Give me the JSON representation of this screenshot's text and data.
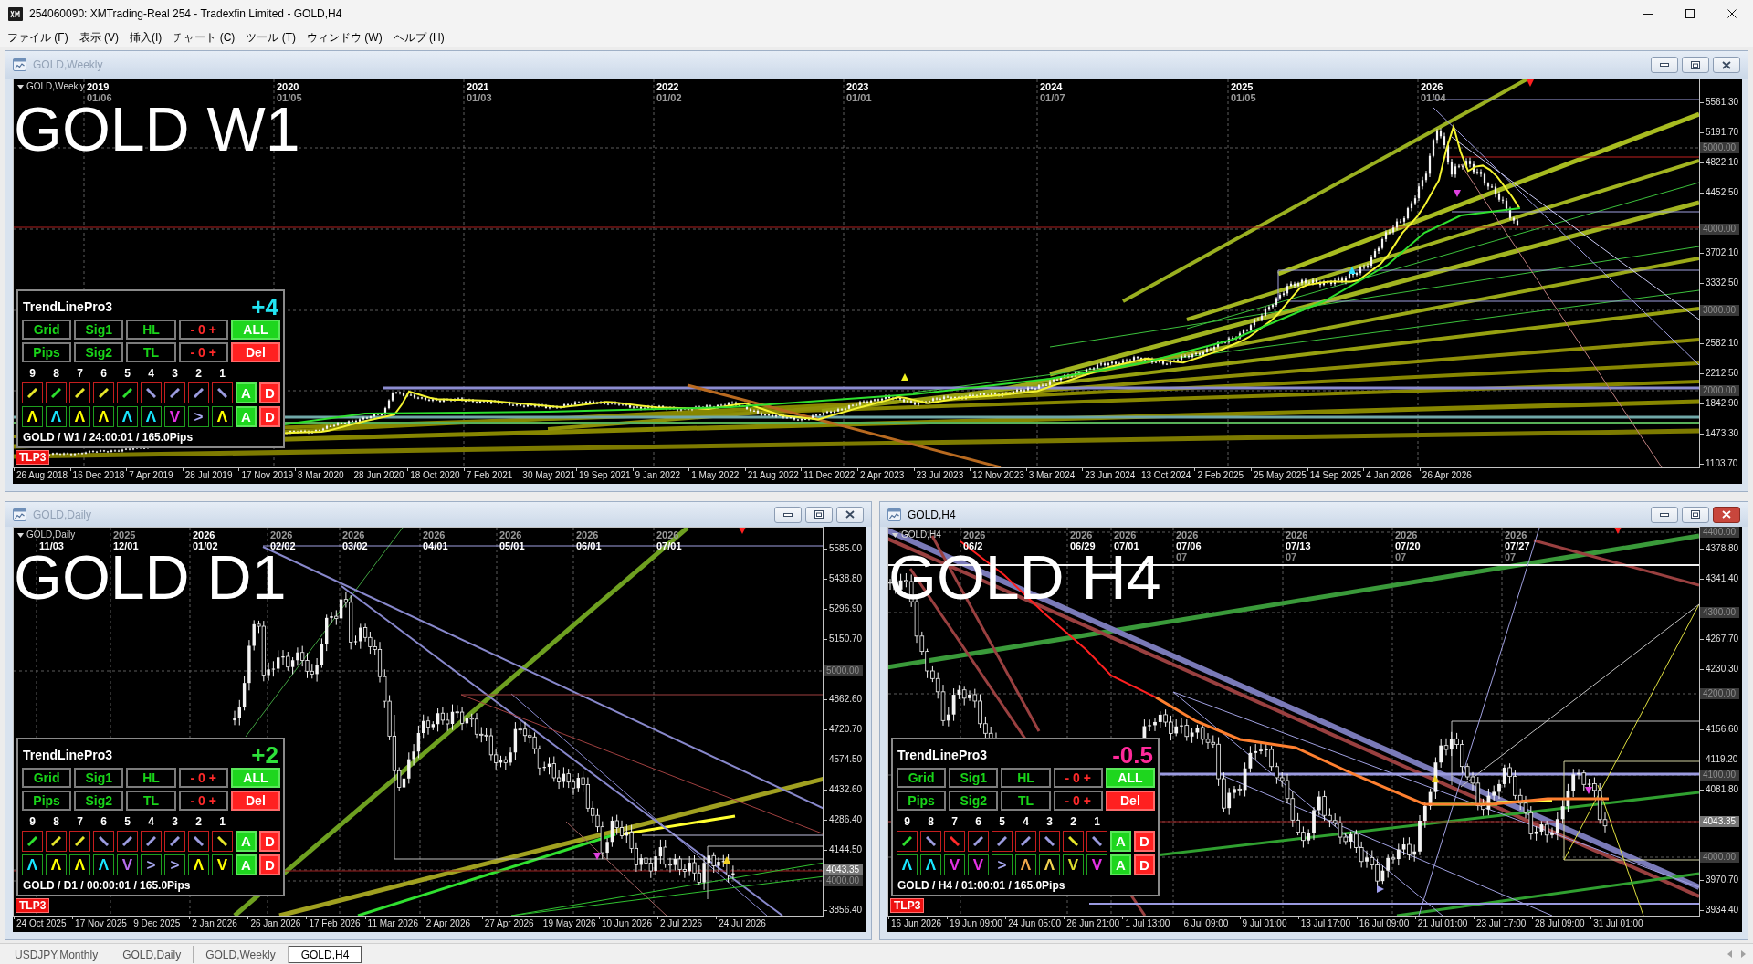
{
  "window": {
    "title": "254060090: XMTrading-Real 254 - Tradexfin Limited - GOLD,H4"
  },
  "menu": [
    "ファイル (F)",
    "表示 (V)",
    "挿入(I)",
    "チャート (C)",
    "ツール (T)",
    "ウィンドウ (W)",
    "ヘルプ (H)"
  ],
  "charts": [
    {
      "title": "GOLD,Weekly",
      "active": false,
      "symbol": "GOLD,Weekly",
      "label": "GOLD W1",
      "top_dates": [
        {
          "year": "2019",
          "date": "01/06",
          "year_highlighted": true,
          "date_highlighted": false
        },
        {
          "year": "2020",
          "date": "01/05",
          "year_highlighted": true,
          "date_highlighted": false
        },
        {
          "year": "2021",
          "date": "01/03",
          "year_highlighted": true,
          "date_highlighted": false
        },
        {
          "year": "2022",
          "date": "01/02",
          "year_highlighted": true,
          "date_highlighted": false
        },
        {
          "year": "2023",
          "date": "01/01",
          "year_highlighted": true,
          "date_highlighted": false
        },
        {
          "year": "2024",
          "date": "01/07",
          "year_highlighted": true,
          "date_highlighted": false
        },
        {
          "year": "2025",
          "date": "01/05",
          "year_highlighted": true,
          "date_highlighted": false
        },
        {
          "year": "2026",
          "date": "01/04",
          "year_highlighted": true,
          "date_highlighted": false
        }
      ],
      "price_ticks": [
        "5561.30",
        "5191.70",
        "4822.10",
        "4452.50",
        "3702.10",
        "3332.50",
        "2582.10",
        "2212.50",
        "1842.90",
        "1473.30",
        "1103.70"
      ],
      "price_marks": [
        {
          "text": "5000.00",
          "kind": "level"
        },
        {
          "text": "4000.00",
          "kind": "level"
        },
        {
          "text": "3000.00",
          "kind": "level"
        },
        {
          "text": "2000.00",
          "kind": "level"
        }
      ],
      "time_ticks": [
        "26 Aug 2018",
        "16 Dec 2018",
        "7 Apr 2019",
        "28 Jul 2019",
        "17 Nov 2019",
        "8 Mar 2020",
        "28 Jun 2020",
        "18 Oct 2020",
        "7 Feb 2021",
        "30 May 2021",
        "19 Sep 2021",
        "9 Jan 2022",
        "1 May 2022",
        "21 Aug 2022",
        "11 Dec 2022",
        "2 Apr 2023",
        "23 Jul 2023",
        "12 Nov 2023",
        "3 Mar 2024",
        "23 Jun 2024",
        "13 Oct 2024",
        "2 Feb 2025",
        "25 May 2025",
        "14 Sep 2025",
        "4 Jan 2026",
        "26 Apr 2026"
      ],
      "panel": {
        "title": "TrendLinePro3",
        "score": {
          "text": "+4",
          "color": "#22e4f2"
        },
        "buttons": [
          {
            "label": "Grid",
            "kind": "toggle"
          },
          {
            "label": "Sig1",
            "kind": "toggle"
          },
          {
            "label": "HL",
            "kind": "toggle"
          },
          {
            "label": "- 0 +",
            "kind": "stepper"
          },
          {
            "label": "ALL",
            "kind": "confirm"
          },
          {
            "label": "Pips",
            "kind": "toggle"
          },
          {
            "label": "Sig2",
            "kind": "toggle"
          },
          {
            "label": "TL",
            "kind": "toggle"
          },
          {
            "label": "- 0 +",
            "kind": "stepper"
          },
          {
            "label": "Del",
            "kind": "danger"
          }
        ],
        "slots": [
          {
            "number": "9",
            "line": {
              "kind": "rising",
              "color": "#e6e62a"
            },
            "arrow": {
              "symbol": "Λ",
              "color": "#ffff00"
            }
          },
          {
            "number": "8",
            "line": {
              "kind": "rising",
              "color": "#2ee02e"
            },
            "arrow": {
              "symbol": "Λ",
              "color": "#19e6ff"
            }
          },
          {
            "number": "7",
            "line": {
              "kind": "rising",
              "color": "#e6e62a"
            },
            "arrow": {
              "symbol": "Λ",
              "color": "#ffff00"
            }
          },
          {
            "number": "6",
            "line": {
              "kind": "rising",
              "color": "#e6e62a"
            },
            "arrow": {
              "symbol": "Λ",
              "color": "#ffff00"
            }
          },
          {
            "number": "5",
            "line": {
              "kind": "rising",
              "color": "#2ee02e"
            },
            "arrow": {
              "symbol": "Λ",
              "color": "#19e6ff"
            }
          },
          {
            "number": "4",
            "line": {
              "kind": "falling",
              "color": "#9c9ce0"
            },
            "arrow": {
              "symbol": "Λ",
              "color": "#19e6ff"
            }
          },
          {
            "number": "3",
            "line": {
              "kind": "rising",
              "color": "#9c9ce0"
            },
            "arrow": {
              "symbol": "V",
              "color": "#e632e6"
            }
          },
          {
            "number": "2",
            "line": {
              "kind": "rising",
              "color": "#9c9ce0"
            },
            "arrow": {
              "symbol": ">",
              "color": "#a8a8f0"
            }
          },
          {
            "number": "1",
            "line": {
              "kind": "falling",
              "color": "#9c9ce0"
            },
            "arrow": {
              "symbol": "Λ",
              "color": "#ffff00"
            }
          }
        ],
        "line_actions": [
          {
            "label": "A",
            "kind": "confirm"
          },
          {
            "label": "D",
            "kind": "danger"
          }
        ],
        "arrow_actions": [
          {
            "label": "A",
            "kind": "confirm"
          },
          {
            "label": "D",
            "kind": "danger"
          }
        ],
        "status": "GOLD / W1 / 24:00:01 / 165.0Pips"
      },
      "badge": "TLP3"
    },
    {
      "title": "GOLD,Daily",
      "active": false,
      "symbol": "GOLD,Daily",
      "label": "GOLD D1",
      "top_dates": [
        {
          "date": "11/03",
          "date_highlighted": true
        },
        {
          "year": "2025",
          "date": "12/01",
          "year_highlighted": false,
          "date_highlighted": true
        },
        {
          "year": "2026",
          "date": "01/02",
          "year_highlighted": true,
          "date_highlighted": true
        },
        {
          "year": "2026",
          "date": "02/02",
          "year_highlighted": false,
          "date_highlighted": true
        },
        {
          "year": "2026",
          "date": "03/02",
          "year_highlighted": false,
          "date_highlighted": true
        },
        {
          "year": "2026",
          "date": "04/01",
          "year_highlighted": false,
          "date_highlighted": true
        },
        {
          "year": "2026",
          "date": "05/01",
          "year_highlighted": false,
          "date_highlighted": true
        },
        {
          "year": "2026",
          "date": "06/01",
          "year_highlighted": false,
          "date_highlighted": true
        },
        {
          "year": "2026",
          "date": "07/01",
          "year_highlighted": false,
          "date_highlighted": true
        }
      ],
      "price_ticks": [
        "5585.00",
        "5438.80",
        "5296.90",
        "5150.70",
        "4862.60",
        "4720.70",
        "4574.50",
        "4432.60",
        "4286.40",
        "4144.50",
        "3856.40"
      ],
      "price_marks": [
        {
          "text": "5000.00",
          "kind": "level"
        },
        {
          "text": "4043.35",
          "kind": "bid"
        },
        {
          "text": "4000.00",
          "kind": "level"
        }
      ],
      "time_ticks": [
        "24 Oct 2025",
        "17 Nov 2025",
        "9 Dec 2025",
        "2 Jan 2026",
        "26 Jan 2026",
        "17 Feb 2026",
        "11 Mar 2026",
        "2 Apr 2026",
        "27 Apr 2026",
        "19 May 2026",
        "10 Jun 2026",
        "2 Jul 2026",
        "24 Jul 2026"
      ],
      "panel": {
        "title": "TrendLinePro3",
        "score": {
          "text": "+2",
          "color": "#2ee03a"
        },
        "buttons": [
          {
            "label": "Grid",
            "kind": "toggle"
          },
          {
            "label": "Sig1",
            "kind": "toggle"
          },
          {
            "label": "HL",
            "kind": "toggle"
          },
          {
            "label": "- 0 +",
            "kind": "stepper"
          },
          {
            "label": "ALL",
            "kind": "confirm"
          },
          {
            "label": "Pips",
            "kind": "toggle"
          },
          {
            "label": "Sig2",
            "kind": "toggle"
          },
          {
            "label": "TL",
            "kind": "toggle"
          },
          {
            "label": "- 0 +",
            "kind": "stepper"
          },
          {
            "label": "Del",
            "kind": "danger"
          }
        ],
        "slots": [
          {
            "number": "9",
            "line": {
              "kind": "rising",
              "color": "#2ee02e"
            },
            "arrow": {
              "symbol": "Λ",
              "color": "#19e6ff"
            }
          },
          {
            "number": "8",
            "line": {
              "kind": "rising",
              "color": "#e6e62a"
            },
            "arrow": {
              "symbol": "Λ",
              "color": "#ffff00"
            }
          },
          {
            "number": "7",
            "line": {
              "kind": "rising",
              "color": "#e6e62a"
            },
            "arrow": {
              "symbol": "Λ",
              "color": "#ffff00"
            }
          },
          {
            "number": "6",
            "line": {
              "kind": "falling",
              "color": "#9c9ce0"
            },
            "arrow": {
              "symbol": "Λ",
              "color": "#19e6ff"
            }
          },
          {
            "number": "5",
            "line": {
              "kind": "rising",
              "color": "#9c9ce0"
            },
            "arrow": {
              "symbol": "V",
              "color": "#b86ef0"
            }
          },
          {
            "number": "4",
            "line": {
              "kind": "rising",
              "color": "#9c9ce0"
            },
            "arrow": {
              "symbol": ">",
              "color": "#a8a8f0"
            }
          },
          {
            "number": "3",
            "line": {
              "kind": "rising",
              "color": "#9c9ce0"
            },
            "arrow": {
              "symbol": ">",
              "color": "#a8a8f0"
            }
          },
          {
            "number": "2",
            "line": {
              "kind": "falling",
              "color": "#9c9ce0"
            },
            "arrow": {
              "symbol": "Λ",
              "color": "#ffff00"
            }
          },
          {
            "number": "1",
            "line": {
              "kind": "falling",
              "color": "#e6e62a"
            },
            "arrow": {
              "symbol": "V",
              "color": "#ffff00"
            }
          }
        ],
        "line_actions": [
          {
            "label": "A",
            "kind": "confirm"
          },
          {
            "label": "D",
            "kind": "danger"
          }
        ],
        "arrow_actions": [
          {
            "label": "A",
            "kind": "confirm"
          },
          {
            "label": "D",
            "kind": "danger"
          }
        ],
        "status": "GOLD / D1 / 00:00:01 / 165.0Pips"
      },
      "badge": "TLP3"
    },
    {
      "title": "GOLD,H4",
      "active": true,
      "symbol": "GOLD,H4",
      "label": "GOLD H4",
      "top_dates": [
        {
          "year": "2026",
          "date": "06/2",
          "year_highlighted": false,
          "date_highlighted": true
        },
        {
          "year": "2026",
          "date": "06/29",
          "year_highlighted": false,
          "date_highlighted": true
        },
        {
          "year": "2026",
          "date": "07/01",
          "year_highlighted": false,
          "date_highlighted": true
        },
        {
          "year": "2026",
          "date": "07/06",
          "sub": "07",
          "year_highlighted": false,
          "date_highlighted": true
        },
        {
          "year": "2026",
          "date": "07/13",
          "sub": "07",
          "year_highlighted": false,
          "date_highlighted": true
        },
        {
          "year": "2026",
          "date": "07/20",
          "sub": "07",
          "year_highlighted": false,
          "date_highlighted": true
        },
        {
          "year": "2026",
          "date": "07/27",
          "sub": "07",
          "year_highlighted": false,
          "date_highlighted": true
        }
      ],
      "price_ticks": [
        "4378.80",
        "4341.40",
        "4267.70",
        "4230.30",
        "4156.60",
        "4119.20",
        "4081.80",
        "3970.70",
        "3934.40"
      ],
      "price_marks": [
        {
          "text": "4400.00",
          "kind": "level"
        },
        {
          "text": "4300.00",
          "kind": "level"
        },
        {
          "text": "4200.00",
          "kind": "level"
        },
        {
          "text": "4100.00",
          "kind": "level"
        },
        {
          "text": "4043.35",
          "kind": "bid"
        },
        {
          "text": "4000.00",
          "kind": "level"
        }
      ],
      "time_ticks": [
        "16 Jun 2026",
        "19 Jun 09:00",
        "24 Jun 05:00",
        "26 Jun 21:00",
        "1 Jul 13:00",
        "6 Jul 09:00",
        "9 Jul 01:00",
        "13 Jul 17:00",
        "16 Jul 09:00",
        "21 Jul 01:00",
        "23 Jul 17:00",
        "28 Jul 09:00",
        "31 Jul 01:00"
      ],
      "panel": {
        "title": "TrendLinePro3",
        "score": {
          "text": "-0.5",
          "color": "#ff2a9a"
        },
        "buttons": [
          {
            "label": "Grid",
            "kind": "toggle"
          },
          {
            "label": "Sig1",
            "kind": "toggle"
          },
          {
            "label": "HL",
            "kind": "toggle"
          },
          {
            "label": "- 0 +",
            "kind": "stepper"
          },
          {
            "label": "ALL",
            "kind": "confirm"
          },
          {
            "label": "Pips",
            "kind": "toggle"
          },
          {
            "label": "Sig2",
            "kind": "toggle"
          },
          {
            "label": "TL",
            "kind": "toggle"
          },
          {
            "label": "- 0 +",
            "kind": "stepper"
          },
          {
            "label": "Del",
            "kind": "danger"
          }
        ],
        "slots": [
          {
            "number": "9",
            "line": {
              "kind": "rising",
              "color": "#2ee02e"
            },
            "arrow": {
              "symbol": "Λ",
              "color": "#19e6ff"
            }
          },
          {
            "number": "8",
            "line": {
              "kind": "falling",
              "color": "#9c9ce0"
            },
            "arrow": {
              "symbol": "Λ",
              "color": "#19e6ff"
            }
          },
          {
            "number": "7",
            "line": {
              "kind": "falling",
              "color": "#ff2a2a"
            },
            "arrow": {
              "symbol": "V",
              "color": "#e632e6"
            }
          },
          {
            "number": "6",
            "line": {
              "kind": "rising",
              "color": "#9c9ce0"
            },
            "arrow": {
              "symbol": "V",
              "color": "#e632e6"
            }
          },
          {
            "number": "5",
            "line": {
              "kind": "rising",
              "color": "#9c9ce0"
            },
            "arrow": {
              "symbol": ">",
              "color": "#a8a8f0"
            }
          },
          {
            "number": "4",
            "line": {
              "kind": "rising",
              "color": "#9c9ce0"
            },
            "arrow": {
              "symbol": "Λ",
              "color": "#f0a84a"
            }
          },
          {
            "number": "3",
            "line": {
              "kind": "falling",
              "color": "#9c9ce0"
            },
            "arrow": {
              "symbol": "Λ",
              "color": "#f0d050"
            }
          },
          {
            "number": "2",
            "line": {
              "kind": "falling",
              "color": "#e6e62a"
            },
            "arrow": {
              "symbol": "V",
              "color": "#e0e030"
            }
          },
          {
            "number": "1",
            "line": {
              "kind": "falling",
              "color": "#9c9ce0"
            },
            "arrow": {
              "symbol": "V",
              "color": "#e632e6"
            }
          }
        ],
        "line_actions": [
          {
            "label": "A",
            "kind": "confirm"
          },
          {
            "label": "D",
            "kind": "danger"
          }
        ],
        "arrow_actions": [
          {
            "label": "A",
            "kind": "confirm"
          },
          {
            "label": "D",
            "kind": "danger"
          }
        ],
        "status": "GOLD / H4 / 01:00:01 / 165.0Pips"
      },
      "badge": "TLP3"
    }
  ],
  "tabs": [
    {
      "label": "USDJPY,Monthly",
      "selected": false
    },
    {
      "label": "GOLD,Daily",
      "selected": false
    },
    {
      "label": "GOLD,Weekly",
      "selected": false
    },
    {
      "label": "GOLD,H4",
      "selected": true
    }
  ]
}
